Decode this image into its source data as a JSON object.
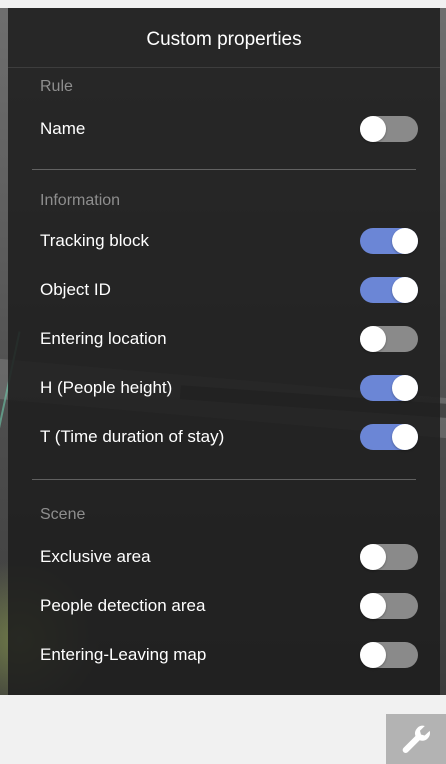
{
  "panel": {
    "title": "Custom properties"
  },
  "sections": [
    {
      "label": "Rule",
      "items": [
        {
          "label": "Name",
          "enabled": false
        }
      ]
    },
    {
      "label": "Information",
      "items": [
        {
          "label": "Tracking block",
          "enabled": true
        },
        {
          "label": "Object ID",
          "enabled": true
        },
        {
          "label": "Entering location",
          "enabled": false
        },
        {
          "label": "H (People height)",
          "enabled": true
        },
        {
          "label": "T (Time duration of stay)",
          "enabled": true
        }
      ]
    },
    {
      "label": "Scene",
      "items": [
        {
          "label": "Exclusive area",
          "enabled": false
        },
        {
          "label": "People detection area",
          "enabled": false
        },
        {
          "label": "Entering-Leaving map",
          "enabled": false
        }
      ]
    }
  ],
  "colors": {
    "toggle_on": "#6b86d6",
    "toggle_off": "#8a8a8a"
  },
  "toolbar": {
    "settings_icon": "wrench-icon"
  }
}
